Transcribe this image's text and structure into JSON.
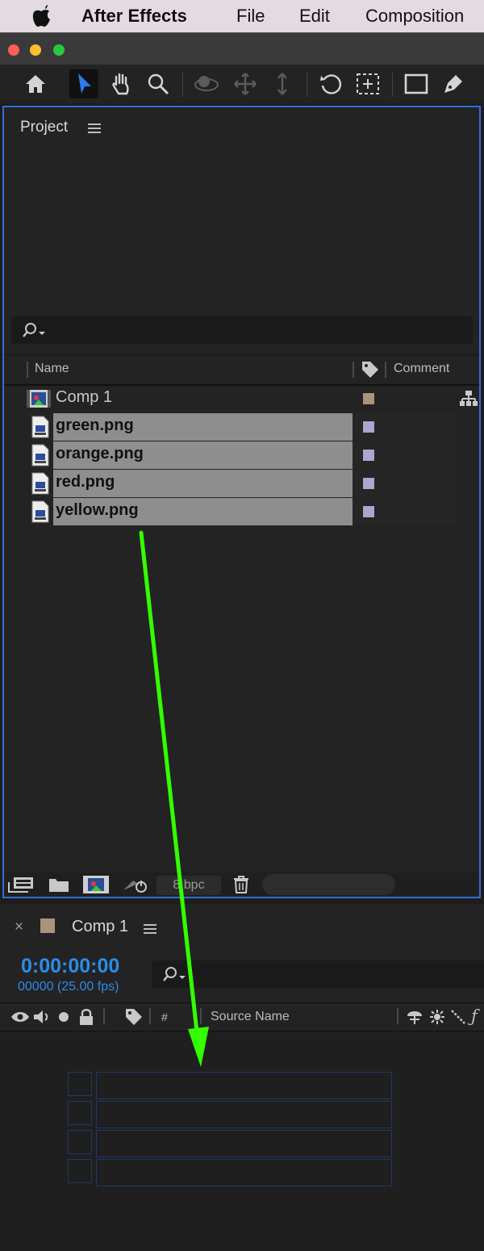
{
  "menubar": {
    "app_name": "After Effects",
    "items": [
      "File",
      "Edit",
      "Composition"
    ]
  },
  "project_panel": {
    "title": "Project",
    "columns": {
      "name": "Name",
      "comment": "Comment"
    },
    "items": [
      {
        "name": "Comp 1",
        "type": "composition",
        "label_color": "#a8957a",
        "selected": false
      },
      {
        "name": "green.png",
        "type": "png",
        "label_color": "#a9a6cf",
        "selected": true
      },
      {
        "name": "orange.png",
        "type": "png",
        "label_color": "#a9a6cf",
        "selected": true
      },
      {
        "name": "red.png",
        "type": "png",
        "label_color": "#a9a6cf",
        "selected": true
      },
      {
        "name": "yellow.png",
        "type": "png",
        "label_color": "#a9a6cf",
        "selected": true
      }
    ],
    "bit_depth": "8 bpc"
  },
  "timeline": {
    "tab_title": "Comp 1",
    "timecode": "0:00:00:00",
    "frame_info": "00000 (25.00 fps)",
    "columns": {
      "number": "#",
      "source_name": "Source Name"
    }
  },
  "drag_arrow_color": "#33ff00",
  "accent_color": "#2a8de8"
}
